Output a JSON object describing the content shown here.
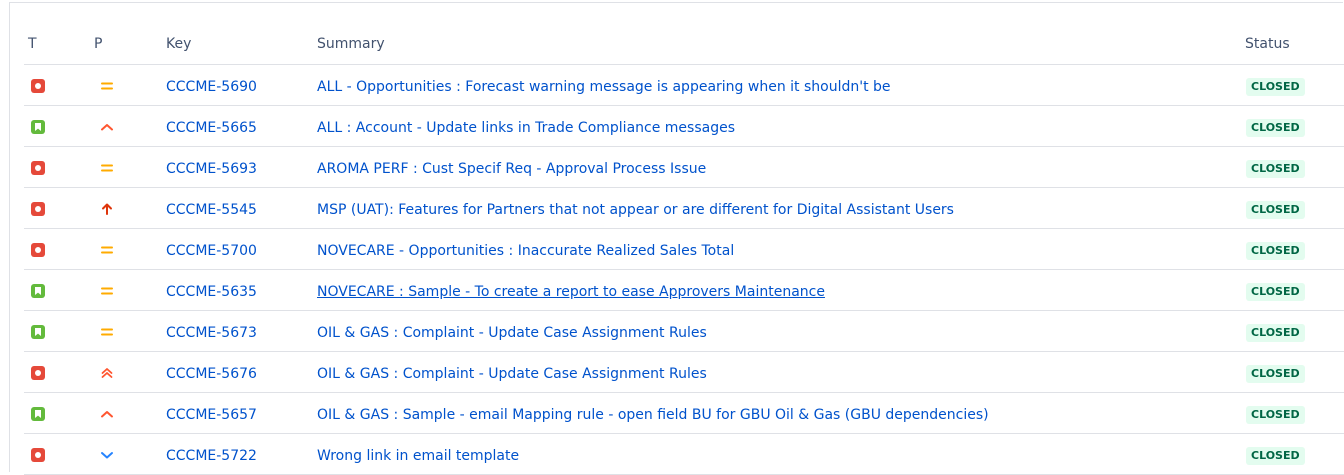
{
  "columns": {
    "type": "T",
    "priority": "P",
    "key": "Key",
    "summary": "Summary",
    "status": "Status"
  },
  "colors": {
    "bug": "#e5493a",
    "story": "#63ba3c",
    "medium": "#ffab00",
    "high": "#ff5630",
    "highest": "#de350b",
    "low": "#2684ff",
    "link": "#0052cc",
    "status_bg": "#e3fcef",
    "status_text": "#006644"
  },
  "issues": [
    {
      "type": "bug",
      "type_icon": "bug-icon",
      "priority": "medium",
      "priority_icon": "priority-medium-icon",
      "key": "CCCME-5690",
      "summary": "ALL - Opportunities : Forecast warning message is appearing when it shouldn't be",
      "status": "CLOSED"
    },
    {
      "type": "story",
      "type_icon": "story-icon",
      "priority": "high",
      "priority_icon": "priority-high-icon",
      "key": "CCCME-5665",
      "summary": "ALL : Account - Update links in Trade Compliance messages",
      "status": "CLOSED"
    },
    {
      "type": "bug",
      "type_icon": "bug-icon",
      "priority": "medium",
      "priority_icon": "priority-medium-icon",
      "key": "CCCME-5693",
      "summary": "AROMA PERF : Cust Specif Req - Approval Process Issue",
      "status": "CLOSED"
    },
    {
      "type": "bug",
      "type_icon": "bug-icon",
      "priority": "highest",
      "priority_icon": "priority-highest-icon",
      "key": "CCCME-5545",
      "summary": "MSP (UAT): Features for Partners that not appear or are different for Digital Assistant Users",
      "status": "CLOSED"
    },
    {
      "type": "bug",
      "type_icon": "bug-icon",
      "priority": "medium",
      "priority_icon": "priority-medium-icon",
      "key": "CCCME-5700",
      "summary": "NOVECARE - Opportunities : Inaccurate Realized Sales Total",
      "status": "CLOSED"
    },
    {
      "type": "story",
      "type_icon": "story-icon",
      "priority": "medium",
      "priority_icon": "priority-medium-icon",
      "key": "CCCME-5635",
      "summary": "NOVECARE : Sample - To create a report to ease Approvers Maintenance",
      "status": "CLOSED",
      "hovered": true
    },
    {
      "type": "story",
      "type_icon": "story-icon",
      "priority": "medium",
      "priority_icon": "priority-medium-icon",
      "key": "CCCME-5673",
      "summary": "OIL & GAS : Complaint - Update Case Assignment Rules",
      "status": "CLOSED"
    },
    {
      "type": "bug",
      "type_icon": "bug-icon",
      "priority": "critical",
      "priority_icon": "priority-critical-icon",
      "key": "CCCME-5676",
      "summary": "OIL & GAS : Complaint - Update Case Assignment Rules",
      "status": "CLOSED"
    },
    {
      "type": "story",
      "type_icon": "story-icon",
      "priority": "high",
      "priority_icon": "priority-high-icon",
      "key": "CCCME-5657",
      "summary": "OIL & GAS : Sample - email Mapping rule - open field BU for GBU Oil & Gas (GBU dependencies)",
      "status": "CLOSED"
    },
    {
      "type": "bug",
      "type_icon": "bug-icon",
      "priority": "low",
      "priority_icon": "priority-low-icon",
      "key": "CCCME-5722",
      "summary": "Wrong link in email template",
      "status": "CLOSED"
    }
  ]
}
